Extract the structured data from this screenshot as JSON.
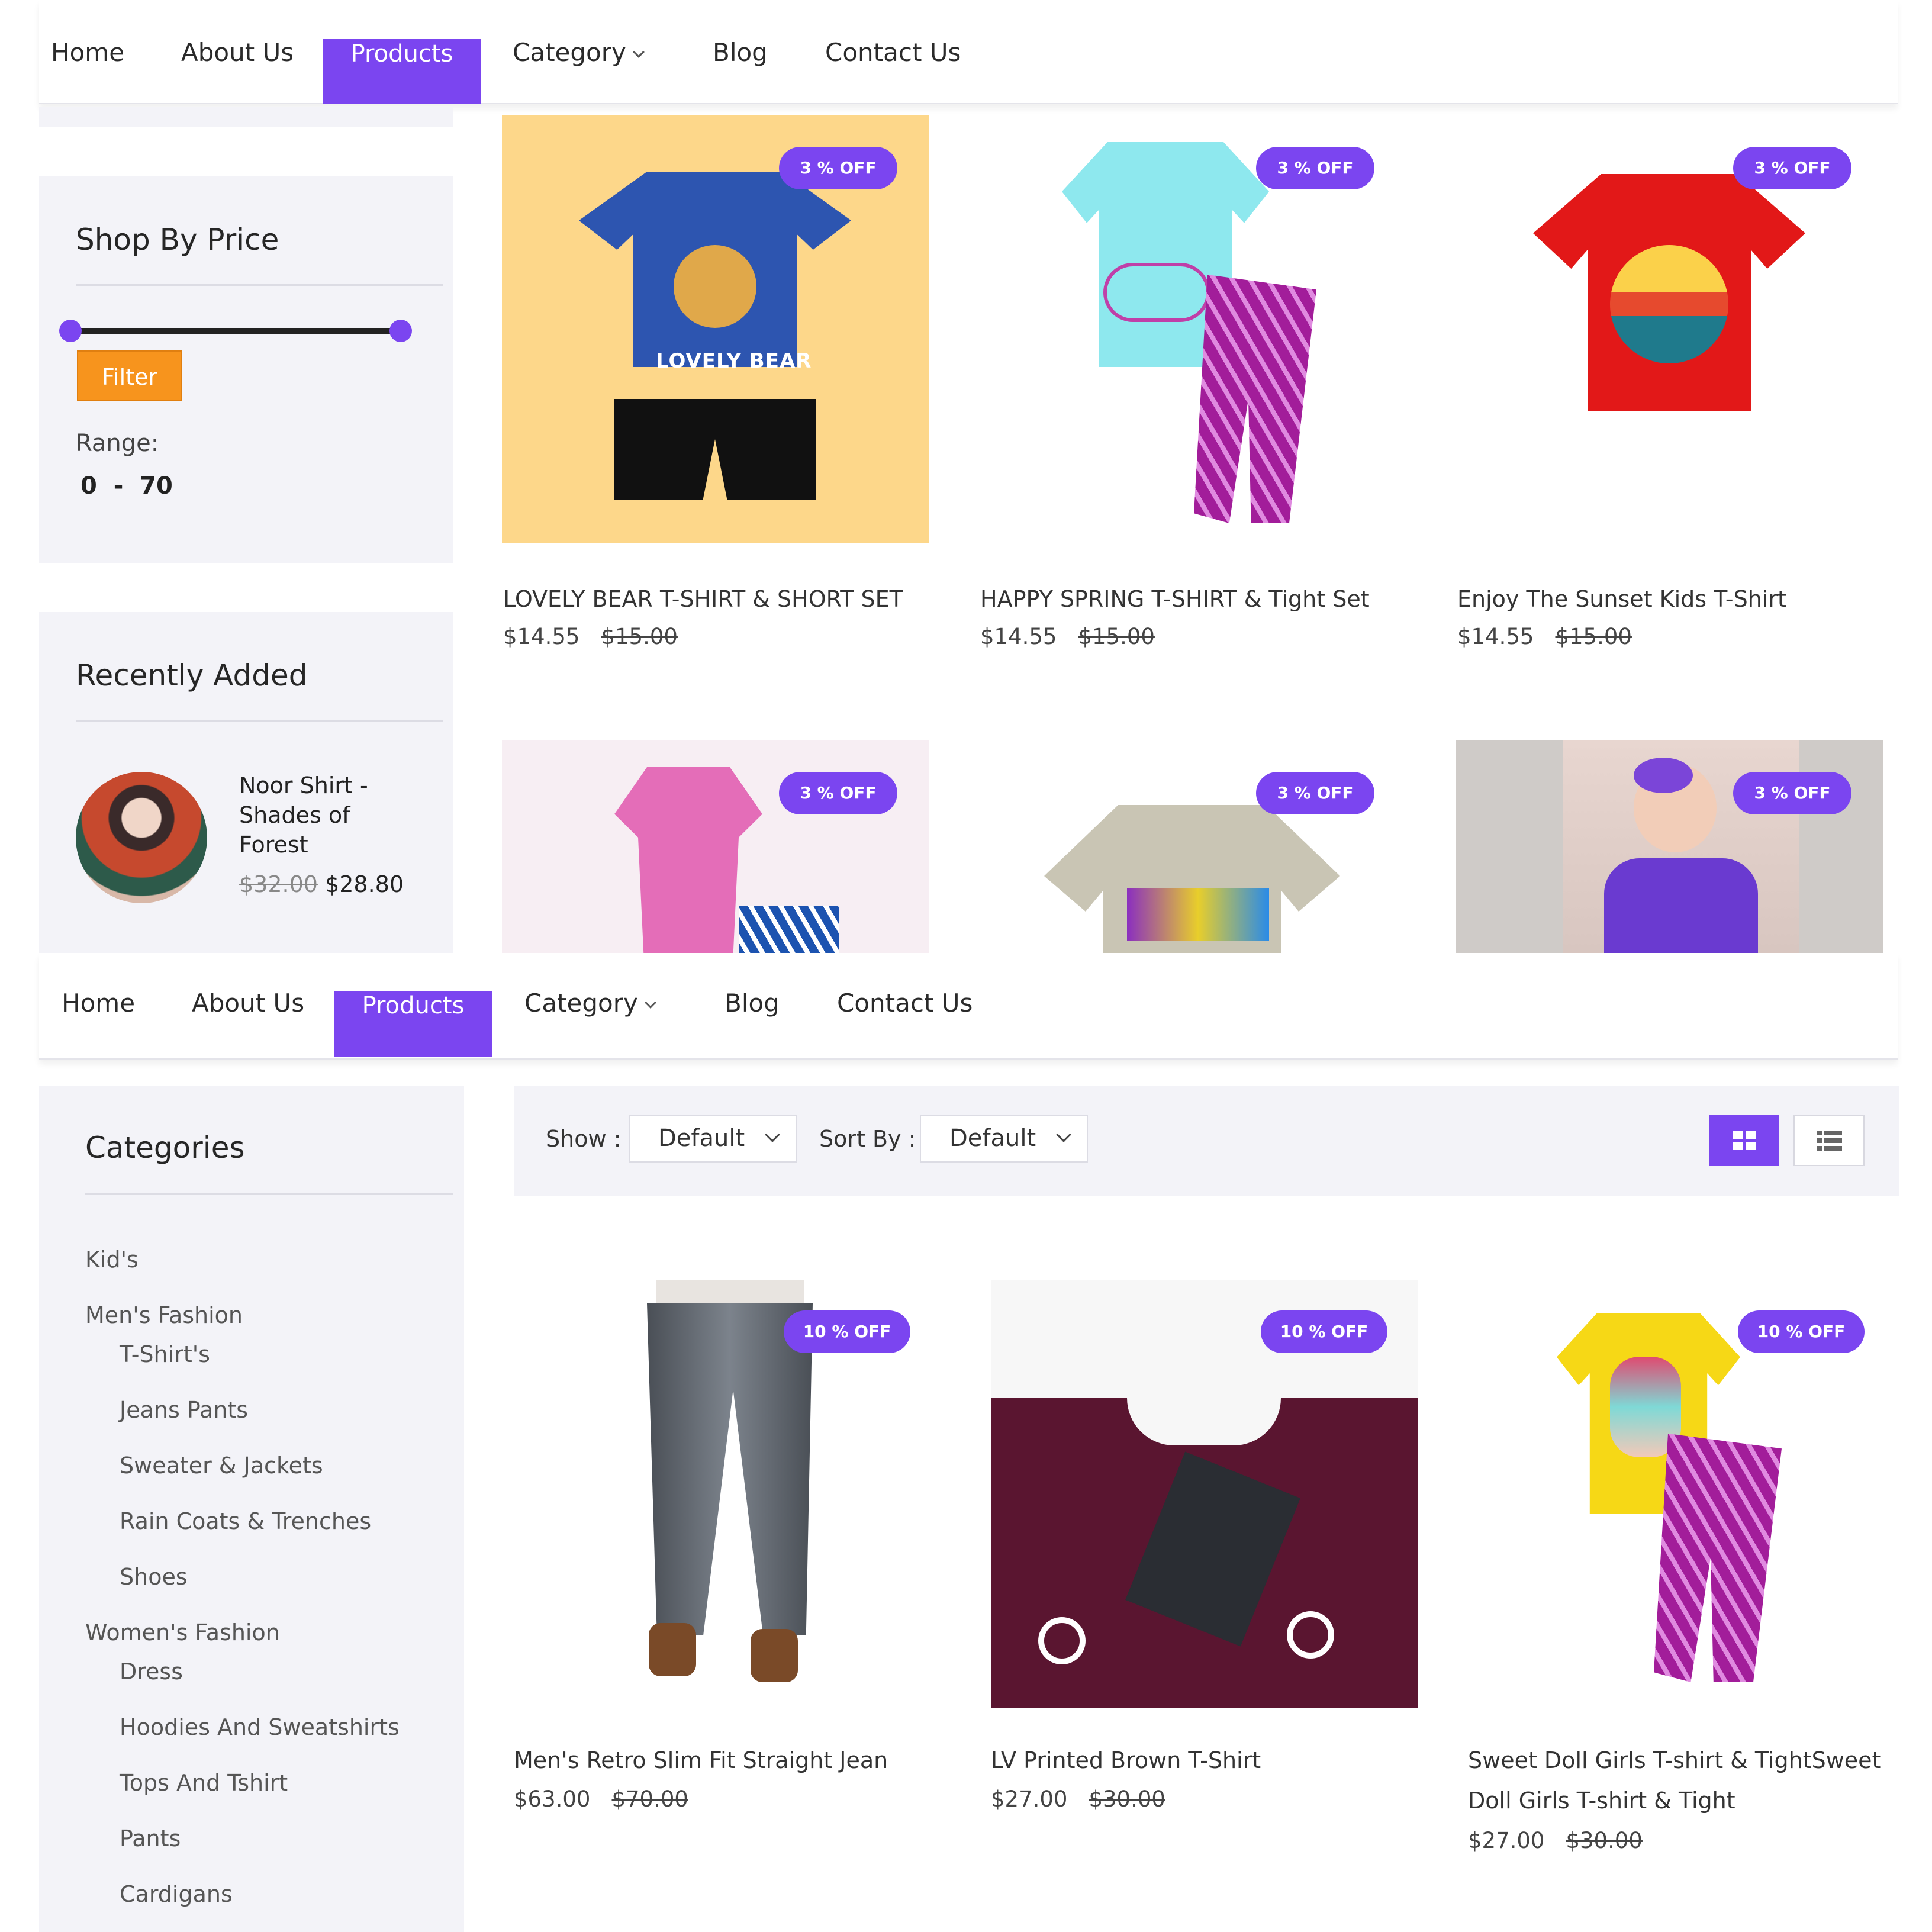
{
  "nav": {
    "items": [
      "Home",
      "About Us",
      "Products",
      "Category",
      "Blog",
      "Contact Us"
    ],
    "active": "Products",
    "accent": "#7b45f0"
  },
  "price_filter": {
    "title": "Shop By Price",
    "button": "Filter",
    "range_label": "Range:",
    "range_min": "0",
    "range_sep": "-",
    "range_max": "70",
    "button_color": "#f7941d"
  },
  "recently_added": {
    "title": "Recently Added",
    "item": {
      "name_line1": "Noor Shirt -",
      "name_line2": "Shades of",
      "name_line3": "Forest",
      "old_price": "$32.00",
      "price": "$28.80"
    }
  },
  "grid1": {
    "products": [
      {
        "name": "LOVELY BEAR T-SHIRT & SHORT SET",
        "price": "$14.55",
        "old_price": "$15.00",
        "badge": "3 % OFF",
        "art": "LOVELY BEAR"
      },
      {
        "name": "HAPPY SPRING T-SHIRT & Tight Set",
        "price": "$14.55",
        "old_price": "$15.00",
        "badge": "3 % OFF"
      },
      {
        "name": "Enjoy The Sunset Kids T-Shirt",
        "price": "$14.55",
        "old_price": "$15.00",
        "badge": "3 % OFF"
      }
    ],
    "row2_badges": [
      "3 % OFF",
      "3 % OFF",
      "3 % OFF"
    ]
  },
  "categories": {
    "title": "Categories",
    "items": [
      {
        "label": "Kid's",
        "level": 0
      },
      {
        "label": "Men's Fashion",
        "level": 0
      },
      {
        "label": "T-Shirt's",
        "level": 1
      },
      {
        "label": "Jeans Pants",
        "level": 1
      },
      {
        "label": "Sweater & Jackets",
        "level": 1
      },
      {
        "label": "Rain Coats & Trenches",
        "level": 1
      },
      {
        "label": "Shoes",
        "level": 1
      },
      {
        "label": "Women's Fashion",
        "level": 0
      },
      {
        "label": "Dress",
        "level": 1
      },
      {
        "label": "Hoodies And Sweatshirts",
        "level": 1
      },
      {
        "label": "Tops And Tshirt",
        "level": 1
      },
      {
        "label": "Pants",
        "level": 1
      },
      {
        "label": "Cardigans",
        "level": 1
      }
    ]
  },
  "toolbar": {
    "show_label": "Show :",
    "show_value": "Default",
    "sort_label": "Sort By :",
    "sort_value": "Default",
    "grid_view_icon": "grid-icon",
    "list_view_icon": "list-icon"
  },
  "grid2": {
    "products": [
      {
        "name": "Men's Retro Slim Fit Straight Jean",
        "price": "$63.00",
        "old_price": "$70.00",
        "badge": "10 % OFF"
      },
      {
        "name": "LV Printed Brown T-Shirt",
        "price": "$27.00",
        "old_price": "$30.00",
        "badge": "10 % OFF"
      },
      {
        "name_line1": "Sweet Doll Girls T-shirt & TightSweet",
        "name_line2": "Doll Girls T-shirt & Tight",
        "price": "$27.00",
        "old_price": "$30.00",
        "badge": "10 % OFF"
      }
    ]
  }
}
